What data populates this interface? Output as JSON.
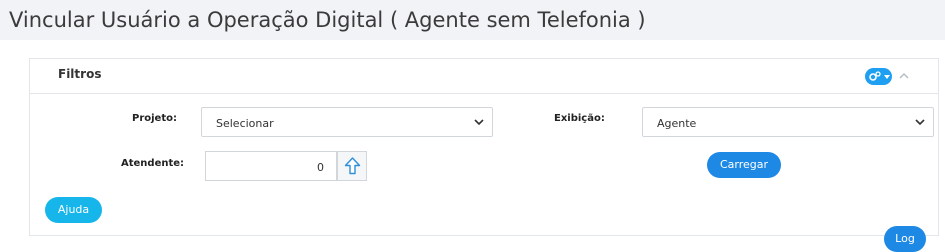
{
  "header": {
    "title": "Vincular Usuário a Operação Digital ( Agente sem Telefonia )"
  },
  "panel": {
    "title": "Filtros",
    "settings_icon": "gears-icon",
    "collapse_icon": "chevron-up-icon"
  },
  "filters": {
    "projeto_label": "Projeto:",
    "projeto_value": "Selecionar",
    "exibicao_label": "Exibição:",
    "exibicao_value": "Agente",
    "atendente_label": "Atendente:",
    "atendente_value": "0"
  },
  "buttons": {
    "carregar": "Carregar",
    "ajuda": "Ajuda",
    "log": "Log"
  },
  "colors": {
    "primary": "#1e88e5",
    "info": "#17b6ea",
    "header_bg": "#f1f3f6"
  }
}
